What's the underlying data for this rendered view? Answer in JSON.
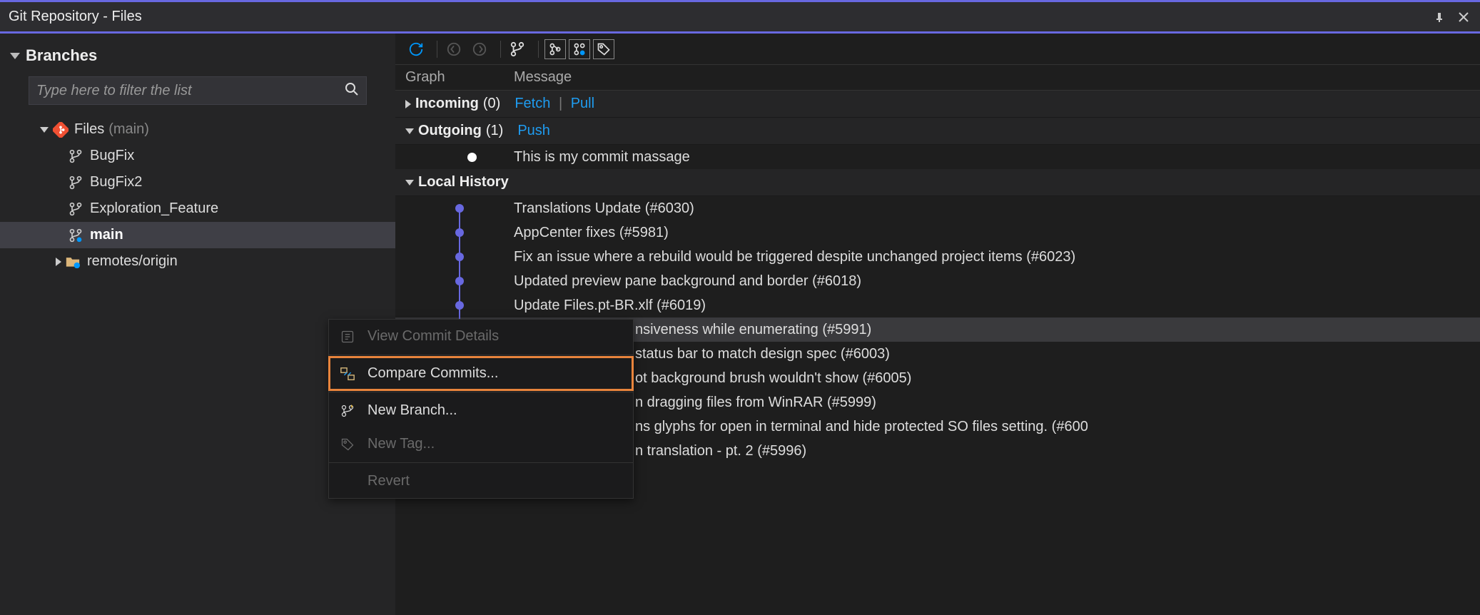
{
  "titlebar": {
    "title": "Git Repository - Files"
  },
  "sidebar": {
    "section": "Branches",
    "filter_placeholder": "Type here to filter the list",
    "root": {
      "label": "Files",
      "current": "(main)"
    },
    "branches": [
      {
        "name": "BugFix",
        "current": false
      },
      {
        "name": "BugFix2",
        "current": false
      },
      {
        "name": "Exploration_Feature",
        "current": false
      },
      {
        "name": "main",
        "current": true
      }
    ],
    "remotes_label": "remotes/origin"
  },
  "toolbar": {
    "col_graph": "Graph",
    "col_message": "Message"
  },
  "history": {
    "incoming": {
      "label": "Incoming",
      "count": "(0)",
      "fetch": "Fetch",
      "pull": "Pull"
    },
    "outgoing": {
      "label": "Outgoing",
      "count": "(1)",
      "push": "Push"
    },
    "outgoing_commit": "This is my commit massage",
    "local_label": "Local History",
    "commits": [
      "Translations Update (#6030)",
      "AppCenter fixes (#5981)",
      " Fix an issue where a rebuild would be triggered despite unchanged project items (#6023)",
      "Updated preview pane background and border (#6018)",
      "Update Files.pt-BR.xlf (#6019)",
      "nsiveness while enumerating (#5991)",
      "status bar to match design spec (#6003)",
      "ot background brush wouldn't show (#6005)",
      "n dragging files from WinRAR (#5999)",
      "ns glyphs for open in terminal and hide protected SO files setting. (#600",
      "n translation - pt. 2 (#5996)"
    ]
  },
  "context_menu": {
    "view_details": "View Commit Details",
    "compare": "Compare Commits...",
    "new_branch": "New Branch...",
    "new_tag": "New Tag...",
    "revert": "Revert"
  }
}
